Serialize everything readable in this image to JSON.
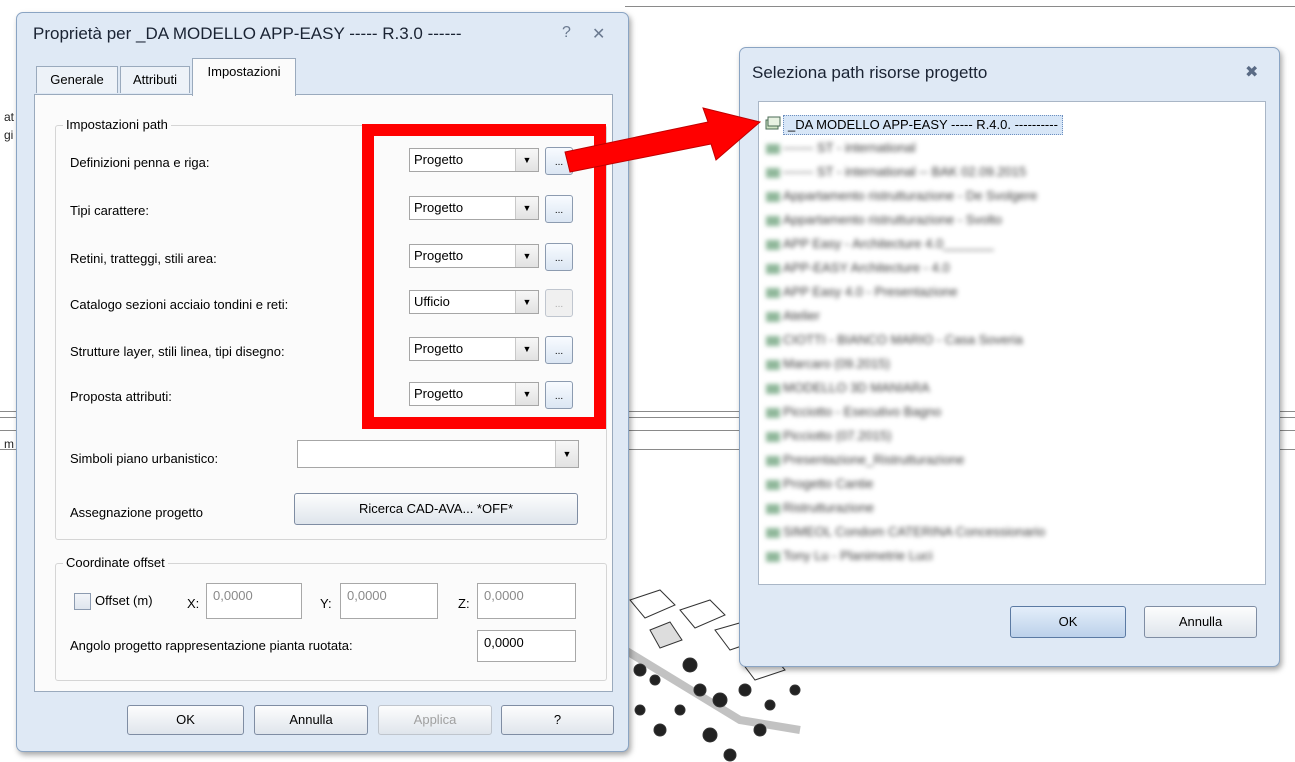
{
  "dialog1": {
    "title": "Proprietà per _DA MODELLO APP-EASY ----- R.3.0 ------",
    "help_glyph": "?",
    "close_glyph": "✕",
    "tabs": [
      {
        "label": "Generale",
        "active": false
      },
      {
        "label": "Attributi",
        "active": false
      },
      {
        "label": "Impostazioni",
        "active": true
      }
    ],
    "path_group": {
      "label": "Impostazioni path",
      "rows": [
        {
          "label": "Definizioni penna e riga:",
          "value": "Progetto",
          "dots": "...",
          "dots_enabled": true
        },
        {
          "label": "Tipi carattere:",
          "value": "Progetto",
          "dots": "...",
          "dots_enabled": true
        },
        {
          "label": "Retini, tratteggi, stili area:",
          "value": "Progetto",
          "dots": "...",
          "dots_enabled": true
        },
        {
          "label": "Catalogo sezioni acciaio tondini e reti:",
          "value": "Ufficio",
          "dots": "...",
          "dots_enabled": false
        },
        {
          "label": "Strutture layer, stili linea, tipi disegno:",
          "value": "Progetto",
          "dots": "...",
          "dots_enabled": true
        },
        {
          "label": "Proposta attributi:",
          "value": "Progetto",
          "dots": "...",
          "dots_enabled": true
        }
      ],
      "simboli_label": "Simboli piano urbanistico:",
      "simboli_value": "",
      "assegnazione_label": "Assegnazione progetto",
      "assegnazione_button": "Ricerca CAD-AVA... *OFF*"
    },
    "offset_group": {
      "label": "Coordinate offset",
      "offset_checkbox": "Offset (m)",
      "offset_checked": false,
      "x_label": "X:",
      "x_value": "0,0000",
      "y_label": "Y:",
      "y_value": "0,0000",
      "z_label": "Z:",
      "z_value": "0,0000",
      "angle_label": "Angolo progetto rappresentazione pianta ruotata:",
      "angle_value": "0,0000"
    },
    "buttons": {
      "ok": "OK",
      "cancel": "Annulla",
      "apply": "Applica",
      "help": "?"
    }
  },
  "dialog2": {
    "title": "Seleziona path risorse progetto",
    "close_glyph": "✖",
    "items": [
      "_DA MODELLO APP-EASY ----- R.4.0. ----------",
      "------- ST - international",
      "------- ST - international -- BAK 02.09.2015",
      "Appartamento ristrutturazione - De Svolgere",
      "Appartamento ristrutturazione - Svolto",
      "APP Easy - Architecture 4.0_______",
      "APP-EASY Architecture - 4.0",
      "APP Easy 4.0 - Presentazione",
      "Atelier",
      "CIOTTI - BIANCO MARIO - Casa Soveria",
      "Marcaro (09.2015)",
      "MODELLO 3D MANIARA",
      "Picciotto - Esecutivo Bagno",
      "Picciotto (07.2015)",
      "Presentazione_Ristrutturazione",
      "Progetto Cantie",
      "Ristrutturazione",
      "SIMEOL Condom CATERINA Concessionario",
      "Tony Lu - Planimetrie Luci"
    ],
    "buttons": {
      "ok": "OK",
      "cancel": "Annulla"
    }
  },
  "background": {
    "left_text": [
      "at",
      "gi",
      "m"
    ]
  },
  "colors": {
    "annotation": "#ff0000",
    "selection": "#d7e6f7"
  }
}
